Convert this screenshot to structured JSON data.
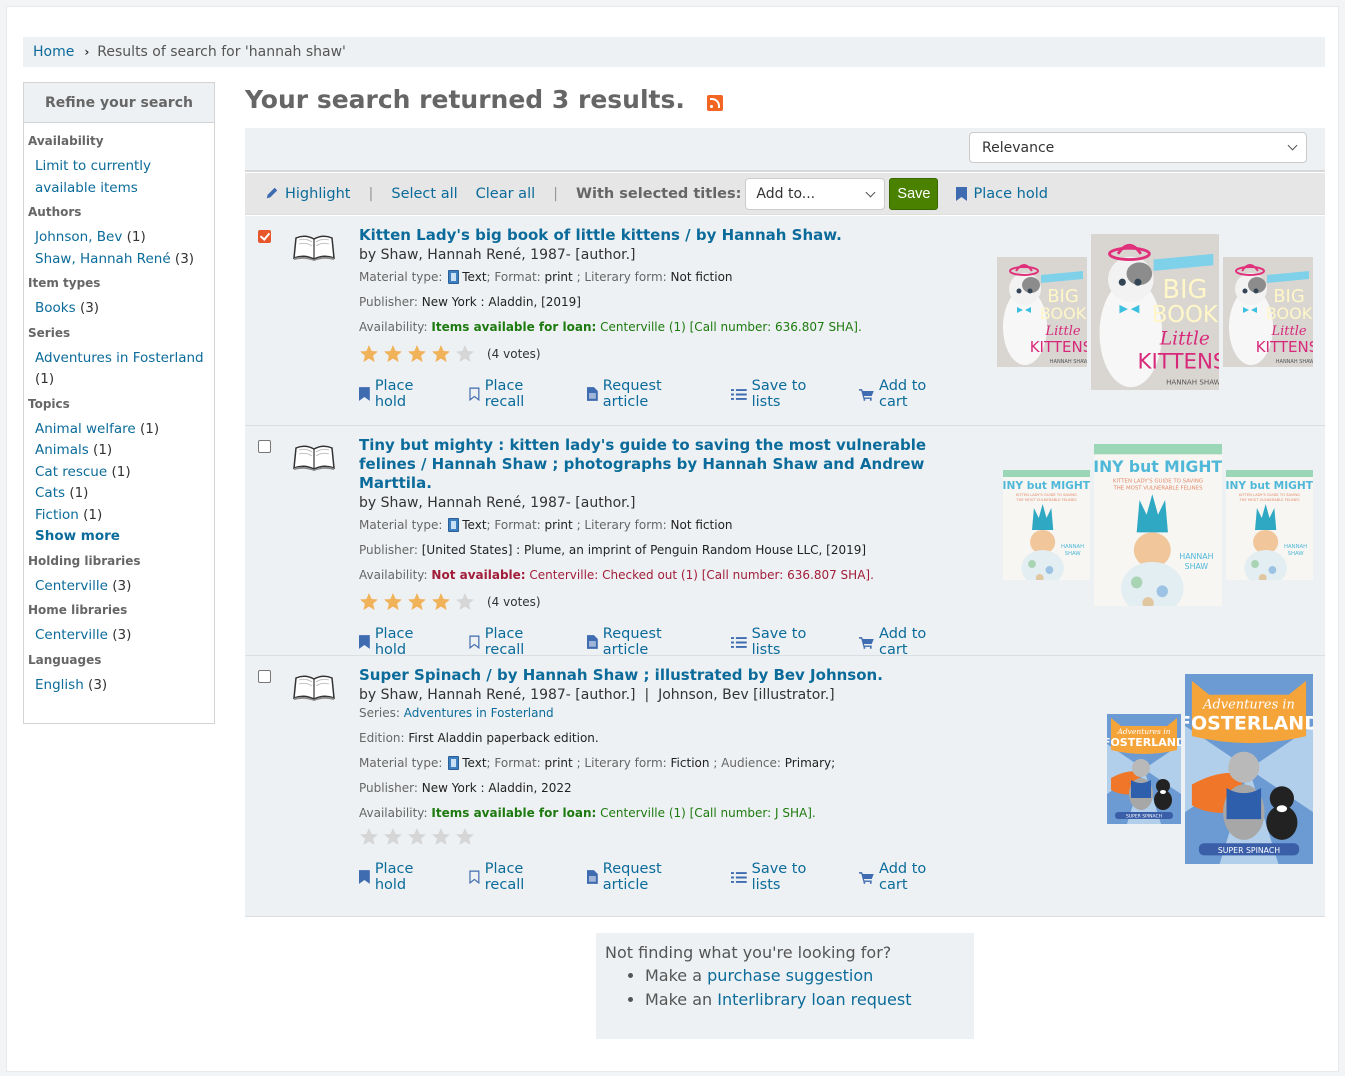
{
  "breadcrumb": {
    "home": "Home",
    "separator": "›",
    "current": "Results of search for 'hannah shaw'"
  },
  "sidebar": {
    "heading": "Refine your search",
    "facets": [
      {
        "title": "Availability",
        "items": [
          {
            "label": "Limit to currently available items",
            "count": ""
          }
        ]
      },
      {
        "title": "Authors",
        "items": [
          {
            "label": "Johnson, Bev",
            "count": "(1)"
          },
          {
            "label": "Shaw, Hannah René",
            "count": "(3)"
          }
        ]
      },
      {
        "title": "Item types",
        "items": [
          {
            "label": "Books",
            "count": "(3)"
          }
        ]
      },
      {
        "title": "Series",
        "items": [
          {
            "label": "Adventures in Fosterland",
            "count": "(1)"
          }
        ]
      },
      {
        "title": "Topics",
        "items": [
          {
            "label": "Animal welfare",
            "count": "(1)"
          },
          {
            "label": "Animals",
            "count": "(1)"
          },
          {
            "label": "Cat rescue",
            "count": "(1)"
          },
          {
            "label": "Cats",
            "count": "(1)"
          },
          {
            "label": "Fiction",
            "count": "(1)"
          }
        ],
        "show_more": "Show more"
      },
      {
        "title": "Holding libraries",
        "items": [
          {
            "label": "Centerville",
            "count": "(3)"
          }
        ]
      },
      {
        "title": "Home libraries",
        "items": [
          {
            "label": "Centerville",
            "count": "(3)"
          }
        ]
      },
      {
        "title": "Languages",
        "items": [
          {
            "label": "English",
            "count": "(3)"
          }
        ]
      }
    ]
  },
  "main": {
    "title": "Your search returned 3 results.",
    "rss_icon": "rss-feed-icon",
    "sort": {
      "selected": "Relevance"
    },
    "toolbar": {
      "highlight": "Highlight",
      "select_all": "Select all",
      "clear_all": "Clear all",
      "with_selected": "With selected titles:",
      "add_to": "Add to...",
      "save": "Save",
      "place_hold": "Place hold"
    },
    "result_labels": {
      "material_type": "Material type:",
      "format": "; Format:",
      "literary_form": "; Literary form:",
      "audience": "; Audience:",
      "publisher": "Publisher:",
      "availability": "Availability:",
      "series": "Series:",
      "edition": "Edition:"
    },
    "actions": {
      "place_hold": "Place hold",
      "place_recall": "Place recall",
      "request_article": "Request article",
      "save_to_lists": "Save to lists",
      "add_to_cart": "Add to cart"
    },
    "results": [
      {
        "checked": true,
        "title": "Kitten Lady's big book of little kittens / by Hannah Shaw.",
        "author": "by Shaw, Hannah René, 1987- [author.]",
        "material_type": "Text",
        "format": "print",
        "literary_form": "Not fiction",
        "publisher": "New York : Aladdin, [2019]",
        "availability_status": "Items available for loan:",
        "availability_detail": "Centerville (1) [Call number: 636.807 SHA].",
        "rating": 4,
        "votes": "(4 votes)",
        "cover_title": "Kitten Lady's Big Book of Little Kittens"
      },
      {
        "checked": false,
        "title": "Tiny but mighty : kitten lady's guide to saving the most vulnerable felines / Hannah Shaw ; photographs by Hannah Shaw and Andrew Marttila.",
        "author": "by Shaw, Hannah René, 1987- [author.]",
        "material_type": "Text",
        "format": "print",
        "literary_form": "Not fiction",
        "publisher": "[United States] : Plume, an imprint of Penguin Random House LLC, [2019]",
        "availability_status": "Not available:",
        "availability_detail": "Centerville: Checked out (1) [Call number: 636.807 SHA].",
        "rating": 4,
        "votes": "(4 votes)",
        "cover_title": "Tiny but Mighty"
      },
      {
        "checked": false,
        "title": "Super Spinach / by Hannah Shaw ; illustrated by Bev Johnson.",
        "author": "by Shaw, Hannah René, 1987- [author.]",
        "author2_sep": "|",
        "author2": "Johnson, Bev [illustrator.]",
        "series": "Adventures in Fosterland",
        "edition": "First Aladdin paperback edition.",
        "material_type": "Text",
        "format": "print",
        "literary_form": "Fiction",
        "audience": "Primary;",
        "publisher": "New York : Aladdin, 2022",
        "availability_status": "Items available for loan:",
        "availability_detail": "Centerville (1) [Call number: J SHA].",
        "rating": 0,
        "votes": "",
        "cover_title": "Adventures in Fosterland: Super Spinach"
      }
    ],
    "not_finding": {
      "heading": "Not finding what you're looking for?",
      "line1_prefix": "Make a",
      "line1_link": "purchase suggestion",
      "line2_prefix": "Make an",
      "line2_link": "Interlibrary loan request"
    }
  },
  "colors": {
    "link": "#0b6b9a",
    "save_button": "#4a8200",
    "available": "#1d7a0f",
    "not_available": "#a11e3a",
    "star_filled": "#f0b35a",
    "star_empty": "#d6d6d6",
    "checkbox_checked": "#e8572b",
    "rss": "#f26522"
  }
}
